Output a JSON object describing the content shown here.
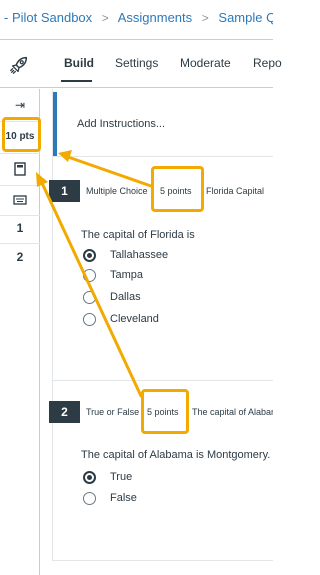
{
  "breadcrumb": {
    "items": [
      "- Pilot Sandbox",
      "Assignments",
      "Sample Quiz",
      "Q"
    ],
    "separator": ">"
  },
  "tabs": [
    "Build",
    "Settings",
    "Moderate",
    "Repo"
  ],
  "siderail": {
    "collapse_glyph": "⇥",
    "points": "10 pts",
    "question_links": [
      "1",
      "2"
    ]
  },
  "instructions": "Add Instructions...",
  "questions": [
    {
      "number": "1",
      "type": "Multiple Choice",
      "points": "5 points",
      "title": "Florida Capital",
      "stem": "The capital of Florida is",
      "options": [
        {
          "label": "Tallahassee",
          "selected": true
        },
        {
          "label": "Tampa",
          "selected": false
        },
        {
          "label": "Dallas",
          "selected": false
        },
        {
          "label": "Cleveland",
          "selected": false
        }
      ]
    },
    {
      "number": "2",
      "type": "True or False",
      "points": "5 points",
      "title": "The capital of Alabama",
      "stem": "The capital of Alabama is Montgomery.",
      "options": [
        {
          "label": "True",
          "selected": true
        },
        {
          "label": "False",
          "selected": false
        }
      ]
    }
  ],
  "colors": {
    "accent": "#2b7abc",
    "callout": "#f2a900",
    "question_badge": "#2d3b45"
  },
  "icons": {
    "rocket": "rocket-icon",
    "collapse": "collapse-arrow-icon",
    "calculator": "calculator-icon",
    "keyboard": "keyboard-icon"
  }
}
